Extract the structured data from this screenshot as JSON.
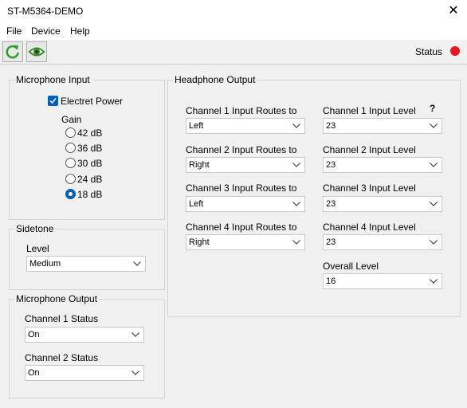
{
  "window": {
    "title": "ST-M5364-DEMO"
  },
  "menu": [
    "File",
    "Device",
    "Help"
  ],
  "toolbar": {
    "status_label": "Status",
    "status_color": "#e8181c"
  },
  "microphone_input": {
    "title": "Microphone Input",
    "electret_power_label": "Electret Power",
    "electret_power_checked": true,
    "gain_label": "Gain",
    "gain_options": [
      "42 dB",
      "36 dB",
      "30 dB",
      "24 dB",
      "18 dB"
    ],
    "gain_selected": "18 dB"
  },
  "sidetone": {
    "title": "Sidetone",
    "level_label": "Level",
    "level_value": "Medium"
  },
  "microphone_output": {
    "title": "Microphone Output",
    "ch1_label": "Channel 1 Status",
    "ch1_value": "On",
    "ch2_label": "Channel 2 Status",
    "ch2_value": "On"
  },
  "headphone_output": {
    "title": "Headphone Output",
    "help": "?",
    "routes": [
      {
        "label": "Channel 1 Input Routes to",
        "value": "Left"
      },
      {
        "label": "Channel 2 Input Routes to",
        "value": "Right"
      },
      {
        "label": "Channel 3 Input Routes to",
        "value": "Left"
      },
      {
        "label": "Channel 4 Input Routes to",
        "value": "Right"
      }
    ],
    "levels": [
      {
        "label": "Channel 1 Input Level",
        "value": "23"
      },
      {
        "label": "Channel 2 Input Level",
        "value": "23"
      },
      {
        "label": "Channel 3 Input Level",
        "value": "23"
      },
      {
        "label": "Channel 4 Input Level",
        "value": "23"
      }
    ],
    "overall_label": "Overall Level",
    "overall_value": "16"
  }
}
